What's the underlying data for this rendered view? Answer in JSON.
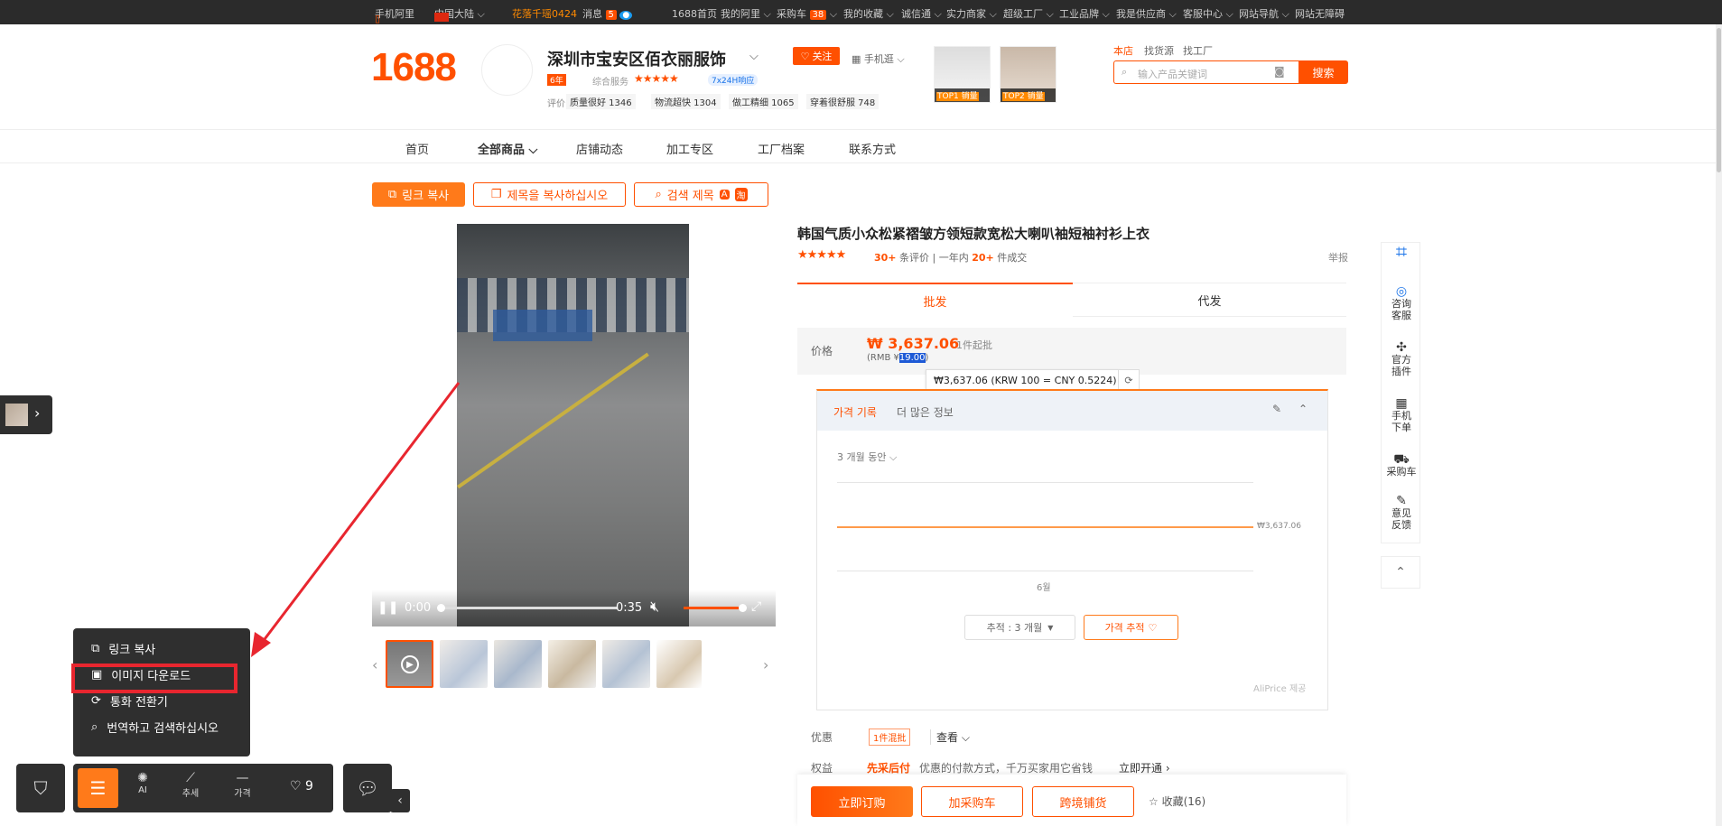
{
  "topbar": {
    "mobile": "手机阿里",
    "region": "中国大陆",
    "promo": "花落千瑶0424",
    "messages": "消息",
    "messages_count": "5",
    "links": [
      "1688首页",
      "我的阿里",
      "采购车",
      "我的收藏",
      "诚信通",
      "实力商家",
      "超级工厂",
      "工业品牌",
      "我是供应商",
      "客服中心",
      "网站导航",
      "网站无障碍"
    ],
    "cart_count": "38"
  },
  "header": {
    "logo": "1688",
    "shop_name": "深圳市宝安区佰衣丽服饰",
    "follow": "关注",
    "mobile_shop": "手机逛",
    "years": "6年",
    "rating_label": "综合服务",
    "service": "7x24H响应",
    "metrics_label": "评价",
    "metrics": [
      "质量很好 1346",
      "物流超快 1304",
      "做工精细 1065",
      "穿着很舒服 748"
    ],
    "top1": "TOP1 销量",
    "top2": "TOP2 销量",
    "search_tabs": [
      "本店",
      "找货源",
      "找工厂"
    ],
    "search_placeholder": "输入产品关键词",
    "search_button": "搜索"
  },
  "nav": [
    "首页",
    "全部商品",
    "店铺动态",
    "加工专区",
    "工厂档案",
    "联系方式"
  ],
  "tools": {
    "copy_link": "링크 복사",
    "copy_title": "제목을 복사하십시오",
    "search_title": "검색 제목"
  },
  "product": {
    "title": "韩国气质小众松紧褶皱方领短款宽松大喇叭袖短袖衬衫上衣",
    "reviews": "30+",
    "reviews_label": "条评价",
    "sold_prefix": "一年内",
    "sold": "20+",
    "sold_suffix": "件成交",
    "report": "举报",
    "tabs": [
      "批发",
      "代发"
    ],
    "price_label": "价格",
    "price": "₩ 3,637.06",
    "moq": "1件起批",
    "rmb_prefix": "(RMB ¥",
    "rmb_value": "19.00",
    "rmb_suffix": ")",
    "conversion": "₩3,637.06 (KRW 100 = CNY 0.5224)"
  },
  "price_history": {
    "tab_active": "가격 기록",
    "tab_more": "더 많은 정보",
    "period": "3 개월 동안",
    "line_label": "₩3,637.06",
    "x_label": "6월",
    "track_select": "추적 : 3 개월",
    "track_button": "가격 추적",
    "credit": "AliPrice 제공"
  },
  "video": {
    "time_current": "0:00",
    "time_total": "0:35"
  },
  "promo": {
    "label": "优惠",
    "badge": "1件混批",
    "view": "查看"
  },
  "rights": {
    "label": "权益",
    "highlight": "先采后付",
    "desc": "优惠的付款方式，千万买家用它省钱",
    "open": "立即开通"
  },
  "actions": {
    "order": "立即订购",
    "cart": "加采购车",
    "cross": "跨境铺货",
    "fav": "收藏(16)"
  },
  "right_sidebar": [
    "咨询客服",
    "官方插件",
    "手机下单",
    "采购车",
    "意见反馈"
  ],
  "context_menu": [
    "링크 복사",
    "이미지 다운로드",
    "통화 전환기",
    "번역하고 검색하십시오"
  ],
  "bottom_bar": {
    "ai": "AI",
    "trend": "추세",
    "price": "가격",
    "fav_count": "9"
  }
}
